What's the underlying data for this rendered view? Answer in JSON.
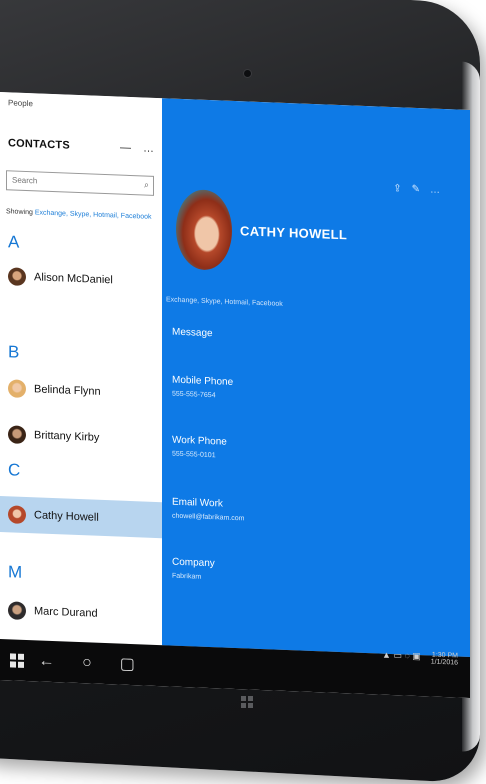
{
  "app": {
    "title": "People"
  },
  "contacts": {
    "heading": "CONTACTS",
    "menu_icons": [
      "—",
      "…"
    ],
    "search_placeholder": "Search",
    "showing_label": "Showing",
    "showing_sources": "Exchange, Skype, Hotmail, Facebook"
  },
  "groups": [
    {
      "letter": "A",
      "people": [
        "Alison McDaniel"
      ]
    },
    {
      "letter": "B",
      "people": [
        "Belinda Flynn",
        "Brittany Kirby"
      ]
    },
    {
      "letter": "C",
      "people": [
        "Cathy Howell"
      ]
    },
    {
      "letter": "M",
      "people": [
        "Marc Durand"
      ]
    }
  ],
  "selected": "Cathy Howell",
  "detail": {
    "name": "CATHY HOWELL",
    "linked": "Exchange, Skype, Hotmail, Facebook",
    "message": "Message",
    "fields": [
      {
        "label": "Mobile Phone",
        "value": "555-555-7654"
      },
      {
        "label": "Work Phone",
        "value": "555-555-0101"
      },
      {
        "label": "Email Work",
        "value": "chowell@fabrikam.com"
      },
      {
        "label": "Company",
        "value": "Fabrikam"
      }
    ]
  },
  "taskbar": {
    "time": "1:30 PM",
    "date": "1/1/2016"
  },
  "colors": {
    "accent": "#0e7ae6",
    "selection": "#b8d5ef",
    "letter": "#1677d4",
    "taskbar": "#0a0a0b"
  }
}
